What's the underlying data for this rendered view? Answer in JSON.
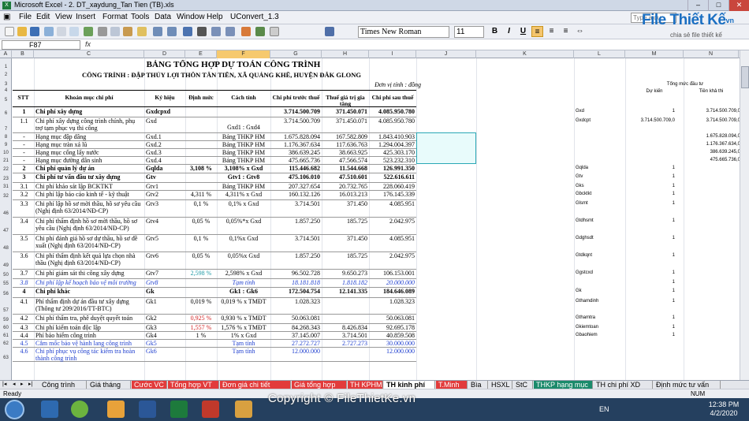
{
  "window": {
    "title": "Microsoft Excel - 2. DT_xaydung_Tan Tien (TB).xls"
  },
  "menu": [
    "File",
    "Edit",
    "View",
    "Insert",
    "Format",
    "Tools",
    "Data",
    "Window",
    "Help",
    "UConvert_1.3"
  ],
  "help_placeholder": "Type a qu",
  "logo": {
    "brand": "File Thiết Kế",
    "domain": ".vn",
    "tagline": "chia sẻ file thiết kế"
  },
  "font": {
    "name": "Times New Roman",
    "size": "11"
  },
  "format_buttons": [
    "B",
    "I",
    "U"
  ],
  "name_box": "F87",
  "fx": "fx",
  "columns": [
    "A",
    "B",
    "C",
    "D",
    "E",
    "F",
    "G",
    "H",
    "I",
    "J",
    "K",
    "L",
    "M",
    "N"
  ],
  "row_numbers": [
    "1",
    "2",
    "3",
    "4",
    "5",
    "6",
    "7",
    "8",
    "9",
    "10",
    "21",
    "22",
    "23",
    "31",
    "32",
    "46",
    "47",
    "48",
    "49",
    "50",
    "55",
    "56",
    "57",
    "59",
    "60",
    "61",
    "62",
    "63",
    "64",
    "65",
    "66",
    "67"
  ],
  "doc": {
    "title": "BẢNG TỔNG HỢP DỰ TOÁN CÔNG TRÌNH",
    "subtitle": "CÔNG TRÌNH : ĐẬP THỦY LỢI THÔN TÂN TIẾN, XÃ QUẢNG KHÊ, HUYỆN ĐẮK GLONG",
    "unit": "Đơn vị tính : đồng",
    "headers": [
      "STT",
      "Khoản mục chi phí",
      "Ký hiệu",
      "Định mức",
      "Cách tính",
      "Chi phí trước thuế",
      "Thuế giá trị gia tăng",
      "Chi phí sau thuế"
    ],
    "side_headers": {
      "m_top": "Tổng mức đầu tư",
      "m": "Dự kiến",
      "n": "Tiền khả thi"
    }
  },
  "rows": [
    {
      "stt": "1",
      "name": "Chi phí xây dựng",
      "code": "Gxdcpxd",
      "rate": "",
      "method": "",
      "pre": "3.714.500.709",
      "vat": "371.450.071",
      "post": "4.085.950.780",
      "k": "Gxd",
      "l": "1",
      "m": "3.714.500.709,0",
      "n": "3.714.500.709,0",
      "style": "b"
    },
    {
      "stt": "1.1",
      "name": "Chi phí xây dựng công trình chính, phụ trợ tạm phục vụ thi công",
      "code": "Gxd",
      "rate": "",
      "method": "Gxd1 : Gxd4",
      "pre": "3.714.500.709",
      "vat": "371.450.071",
      "post": "4.085.950.780",
      "k": "Gxdcpt",
      "l": "3.714.500.709,0",
      "m": "3.714.500.709,0",
      "n": "3.714.500.709,0",
      "style": ""
    },
    {
      "stt": "-",
      "name": "Hạng mục đập dâng",
      "code": "Gxd.1",
      "rate": "",
      "method": "Bảng THKP HM",
      "pre": "1.675.828.094",
      "vat": "167.582.809",
      "post": "1.843.410.903",
      "k": "",
      "l": "",
      "m": "1.675.828.094,0",
      "n": "1.675.828.094,0",
      "style": ""
    },
    {
      "stt": "-",
      "name": "Hạng mục tràn xả lũ",
      "code": "Gxd.2",
      "rate": "",
      "method": "Bảng THKP HM",
      "pre": "1.176.367.634",
      "vat": "117.636.763",
      "post": "1.294.004.397",
      "k": "",
      "l": "",
      "m": "1.176.367.634,0",
      "n": "1.176.367.634,0",
      "style": ""
    },
    {
      "stt": "-",
      "name": "Hạng mục cống lấy nước",
      "code": "Gxd.3",
      "rate": "",
      "method": "Bảng THKP HM",
      "pre": "386.639.245",
      "vat": "38.663.925",
      "post": "425.303.170",
      "k": "",
      "l": "",
      "m": "386.639.245,0",
      "n": "386.639.245,0",
      "style": ""
    },
    {
      "stt": "-",
      "name": "Hạng mục đường dân sinh",
      "code": "Gxd.4",
      "rate": "",
      "method": "Bảng THKP HM",
      "pre": "475.665.736",
      "vat": "47.566.574",
      "post": "523.232.310",
      "k": "",
      "l": "",
      "m": "475.665.736,0",
      "n": "475.665.736,0",
      "style": ""
    },
    {
      "stt": "2",
      "name": "Chi phí quản lý dự án",
      "code": "Gqlda",
      "rate": "3,108 %",
      "method": "3,108% x Gxd",
      "pre": "115.446.682",
      "vat": "11.544.668",
      "post": "126.991.350",
      "k": "Gqlda",
      "l": "1",
      "m": "",
      "n": "",
      "style": "b"
    },
    {
      "stt": "3",
      "name": "Chi phí tư vấn đầu tư xây dựng",
      "code": "Gtv",
      "rate": "",
      "method": "Gtv1 : Gtv8",
      "pre": "475.106.010",
      "vat": "47.510.601",
      "post": "522.616.611",
      "k": "Gtv",
      "l": "1",
      "m": "",
      "n": "",
      "style": "b"
    },
    {
      "stt": "3.1",
      "name": "Chi phí khảo sát lập BCKTKT",
      "code": "Gtv1",
      "rate": "",
      "method": "Bảng THKP HM",
      "pre": "207.327.654",
      "vat": "20.732.765",
      "post": "228.060.419",
      "k": "Gks",
      "l": "1",
      "m": "",
      "n": "",
      "style": ""
    },
    {
      "stt": "3.2",
      "name": "Chi phí lập báo cáo kinh tế - kỹ thuật",
      "code": "Gtv2",
      "rate": "4,311 %",
      "method": "4,311% x Gxd",
      "pre": "160.132.126",
      "vat": "16.013.213",
      "post": "176.145.339",
      "k": "Gbcktkt",
      "l": "1",
      "m": "",
      "n": "",
      "style": ""
    },
    {
      "stt": "3.3",
      "name": "Chi phí lập hồ sơ mời thầu, hồ sơ yêu cầu (Nghị định 63/2014/NĐ-CP)",
      "code": "Gtv3",
      "rate": "0,1 %",
      "method": "0,1% x Gxd",
      "pre": "3.714.501",
      "vat": "371.450",
      "post": "4.085.951",
      "k": "Glsmt",
      "l": "1",
      "m": "",
      "n": "",
      "style": ""
    },
    {
      "stt": "3.4",
      "name": "Chi phí thẩm định hồ sơ mời thầu, hồ sơ yêu cầu (Nghị định 63/2014/NĐ-CP)",
      "code": "Gtv4",
      "rate": "0,05 %",
      "method": "0,05%*x Gxd",
      "pre": "1.857.250",
      "vat": "185.725",
      "post": "2.042.975",
      "k": "Gtdhsmt",
      "l": "1",
      "m": "",
      "n": "",
      "style": ""
    },
    {
      "stt": "3.5",
      "name": "Chi phí đánh giá hồ sơ dự thầu, hồ sơ đề xuất (Nghị định 63/2014/NĐ-CP)",
      "code": "Gtv5",
      "rate": "0,1 %",
      "method": "0,1%x Gxd",
      "pre": "3.714.501",
      "vat": "371.450",
      "post": "4.085.951",
      "k": "Gdghsdt",
      "l": "1",
      "m": "",
      "n": "",
      "style": ""
    },
    {
      "stt": "3.6",
      "name": "Chi phí thẩm định kết quả lựa chọn nhà thầu (Nghị định 63/2014/NĐ-CP)",
      "code": "Gtv6",
      "rate": "0,05 %",
      "method": "0,05%x Gxd",
      "pre": "1.857.250",
      "vat": "185.725",
      "post": "2.042.975",
      "k": "Gtdkqnt",
      "l": "1",
      "m": "",
      "n": "",
      "style": ""
    },
    {
      "stt": "3.7",
      "name": "Chi phí giám sát thi công xây dựng",
      "code": "Gtv7",
      "rate": "2,598 %",
      "method": "2,598% x Gxd",
      "pre": "96.502.728",
      "vat": "9.650.273",
      "post": "106.153.001",
      "k": "Ggstcxd",
      "l": "1",
      "m": "",
      "n": "",
      "style": "",
      "rate_color": "teal"
    },
    {
      "stt": "3.8",
      "name": "Chi phí lập kế hoạch bảo vệ môi trường",
      "code": "Gtv8",
      "rate": "",
      "method": "Tạm tính",
      "pre": "18.181.818",
      "vat": "1.818.182",
      "post": "20.000.000",
      "k": "",
      "l": "1",
      "m": "",
      "n": "",
      "style": "blue ital"
    },
    {
      "stt": "4",
      "name": "Chi phí khác",
      "code": "Gk",
      "rate": "",
      "method": "Gk1 : Gk6",
      "pre": "172.504.754",
      "vat": "12.141.335",
      "post": "184.646.089",
      "k": "Gk",
      "l": "1",
      "m": "",
      "n": "",
      "style": "b"
    },
    {
      "stt": "4.1",
      "name": "Phí thẩm định dự án đầu tư xây dựng (Thông tư 209/2016/TT-BTC)",
      "code": "Gk1",
      "rate": "0,019 %",
      "method": "0,019 % x TMĐT",
      "pre": "1.028.323",
      "vat": "",
      "post": "1.028.323",
      "k": "Gthamdinh",
      "l": "1",
      "m": "",
      "n": "",
      "style": ""
    },
    {
      "stt": "4.2",
      "name": "Chi phí thẩm tra, phê duyệt quyết toán",
      "code": "Gk2",
      "rate": "0,925 %",
      "method": "0,930 % x TMĐT",
      "pre": "50.063.081",
      "vat": "",
      "post": "50.063.081",
      "k": "Gthamtra",
      "l": "1",
      "m": "",
      "n": "",
      "style": "",
      "rate_color": "red"
    },
    {
      "stt": "4.3",
      "name": "Chi phí kiểm toán độc lập",
      "code": "Gk3",
      "rate": "1,557 %",
      "method": "1,576 % x TMĐT",
      "pre": "84.268.343",
      "vat": "8.426.834",
      "post": "92.695.178",
      "k": "Gkiemtoan",
      "l": "1",
      "m": "",
      "n": "",
      "style": "",
      "rate_color": "red"
    },
    {
      "stt": "4.4",
      "name": "Phí bảo hiểm công trình",
      "code": "Gk4",
      "rate": "1 %",
      "method": "1% x Gxd",
      "pre": "37.145.007",
      "vat": "3.714.501",
      "post": "40.859.508",
      "k": "Gbaohiem",
      "l": "1",
      "m": "",
      "n": "",
      "style": ""
    },
    {
      "stt": "4.5",
      "name": "Cắm mốc bảo vệ hành lang công trình",
      "code": "Gk5",
      "rate": "",
      "method": "Tạm tính",
      "pre": "27.272.727",
      "vat": "2.727.273",
      "post": "30.000.000",
      "k": "",
      "l": "",
      "m": "",
      "n": "",
      "style": "blue"
    },
    {
      "stt": "4.6",
      "name": "Chi phí phục vụ công tác kiểm tra hoàn thành công trình",
      "code": "Gk6",
      "rate": "",
      "method": "Tạm tính",
      "pre": "12.000.000",
      "vat": "",
      "post": "12.000.000",
      "k": "",
      "l": "",
      "m": "",
      "n": "",
      "style": "blue"
    }
  ],
  "sheet_tabs": [
    "Công trình",
    "Giá tháng",
    "Cước VC",
    "Tổng hợp VT",
    "Đơn giá chi tiết",
    "Giá tổng hợp",
    "TH KPHM",
    "TH kinh phí",
    "T.Minh",
    "Bìa",
    "HSXL",
    "StC",
    "THKP hạng mục",
    "TH chi phí XD",
    "Định mức tư vấn"
  ],
  "status": {
    "ready": "Ready",
    "num": "NUM"
  },
  "taskbar": {
    "lang": "EN",
    "time": "12:38 PM",
    "date": "4/2/2020"
  },
  "watermark": "Copyright © FileThietKe.vn"
}
